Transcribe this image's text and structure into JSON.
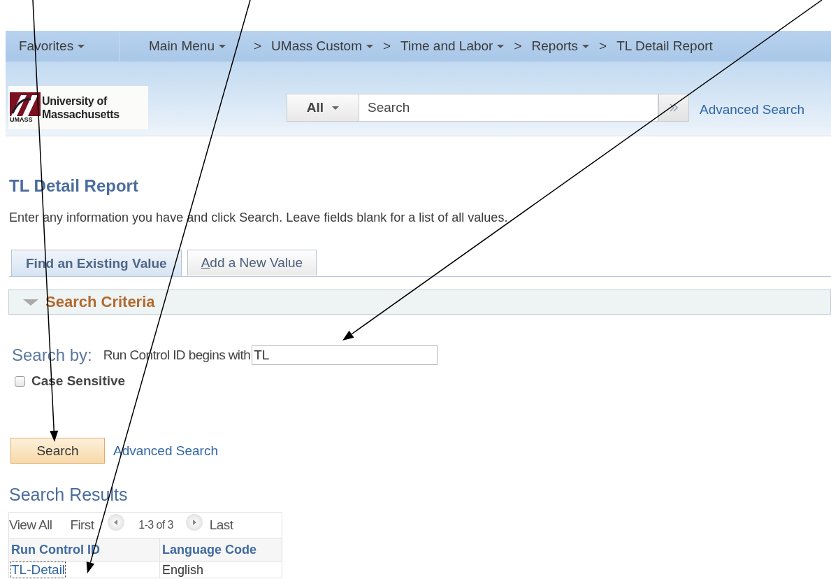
{
  "nav_bar": {
    "menus": [
      {
        "label": "Favorites",
        "dropdown": true
      },
      {
        "label": "Main Menu",
        "dropdown": true
      }
    ],
    "breadcrumbs": [
      {
        "label": "UMass Custom",
        "dropdown": true
      },
      {
        "label": "Time and Labor",
        "dropdown": true
      },
      {
        "label": "Reports",
        "dropdown": true
      },
      {
        "label": "TL Detail Report",
        "dropdown": false
      }
    ],
    "separator": ">"
  },
  "header": {
    "logo": {
      "line_1": "University of",
      "line_2": "Massachusetts",
      "mark": "UMASS"
    },
    "search": {
      "scope": "All",
      "placeholder": "Search"
    },
    "advanced_search_link": "Advanced Search"
  },
  "page": {
    "title": "TL Detail Report",
    "instructions": "Enter any information you have and click Search. Leave fields blank for a list of all values.",
    "tabs": [
      {
        "label": "Find an Existing Value",
        "selected": true,
        "underlined_initial": false
      },
      {
        "label": "Add a New Value",
        "selected": false,
        "underlined_initial": true
      }
    ],
    "section": {
      "title": "Search Criteria",
      "expanded": true
    },
    "search_by": {
      "label": "Search by:",
      "field_label": "Run Control ID begins with",
      "value": "TL"
    },
    "case_sensitive": {
      "label": "Case Sensitive",
      "checked": false
    },
    "search_button": "Search",
    "advanced_search_link": "Advanced Search",
    "results": {
      "title": "Search Results",
      "navigation": {
        "view_all": "View All",
        "first": "First",
        "range": "1-3 of 3",
        "last": "Last"
      },
      "columns": [
        "Run Control ID",
        "Language Code"
      ],
      "rows": [
        {
          "cells": [
            "TL-Detail",
            "English"
          ],
          "focused": true
        }
      ]
    }
  },
  "annotations": [
    {
      "kind": "arrow"
    },
    {
      "kind": "arrow"
    },
    {
      "kind": "arrow"
    }
  ]
}
